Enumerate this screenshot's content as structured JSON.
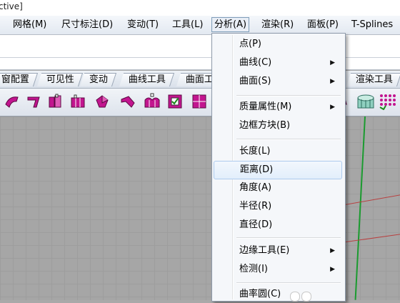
{
  "window": {
    "title_fragment": "ctive]"
  },
  "menubar": {
    "items": [
      {
        "id": "mesh",
        "label": "网格(M)"
      },
      {
        "id": "dimension",
        "label": "尺寸标注(D)"
      },
      {
        "id": "transform",
        "label": "变动(T)"
      },
      {
        "id": "tools",
        "label": "工具(L)"
      },
      {
        "id": "analyze",
        "label": "分析(A)",
        "active": true
      },
      {
        "id": "render",
        "label": "渲染(R)"
      },
      {
        "id": "panels",
        "label": "面板(P)"
      },
      {
        "id": "tsplines",
        "label": "T-Splines"
      }
    ]
  },
  "tabbar": {
    "tabs": [
      {
        "label": "窗配置"
      },
      {
        "label": "可见性"
      },
      {
        "label": "变动"
      },
      {
        "label": "曲线工具"
      },
      {
        "label": "曲面工"
      },
      {
        "label": "渲染工具"
      }
    ]
  },
  "toolbar": {
    "icons": [
      {
        "name": "fillet-surface-icon",
        "color": "#c2158f"
      },
      {
        "name": "extrude-curve-icon",
        "color": "#c2158f"
      },
      {
        "name": "loft-icon",
        "color": "#c2158f"
      },
      {
        "name": "sweep-icon",
        "color": "#c2158f"
      },
      {
        "name": "revolve-icon",
        "color": "#c2158f"
      },
      {
        "name": "blend-surface-icon",
        "color": "#c2158f"
      },
      {
        "name": "network-surface-icon",
        "color": "#c2158f"
      },
      {
        "name": "patch-check-icon",
        "color": "#c2158f"
      },
      {
        "name": "grid-surface-icon",
        "color": "#c2158f"
      },
      {
        "name": "flow-along-surface-icon",
        "color": "#c2158f"
      },
      {
        "name": "cylinder-strip-icon",
        "color": "#4a9a8a"
      },
      {
        "name": "point-grid-icon",
        "color": "#c2158f"
      }
    ]
  },
  "dropdown": {
    "items": [
      {
        "label": "点(P)",
        "submenu": false
      },
      {
        "label": "曲线(C)",
        "submenu": true
      },
      {
        "label": "曲面(S)",
        "submenu": true
      },
      {
        "sep": true
      },
      {
        "label": "质量属性(M)",
        "submenu": true
      },
      {
        "label": "边框方块(B)",
        "submenu": false
      },
      {
        "sep": true
      },
      {
        "label": "长度(L)",
        "submenu": false
      },
      {
        "label": "距离(D)",
        "submenu": false,
        "hover": true
      },
      {
        "label": "角度(A)",
        "submenu": false
      },
      {
        "label": "半径(R)",
        "submenu": false
      },
      {
        "label": "直径(D)",
        "submenu": false
      },
      {
        "sep": true
      },
      {
        "label": "边缘工具(E)",
        "submenu": true
      },
      {
        "label": "检测(I)",
        "submenu": true
      },
      {
        "sep": true
      },
      {
        "label": "曲率圆(C)",
        "submenu": false
      }
    ]
  },
  "colors": {
    "accent_icon": "#c2158f",
    "grid_bg": "#a6a6a6",
    "axis_green": "#1a9b2f",
    "axis_red": "#b84040",
    "hover_border": "#aecbee"
  }
}
